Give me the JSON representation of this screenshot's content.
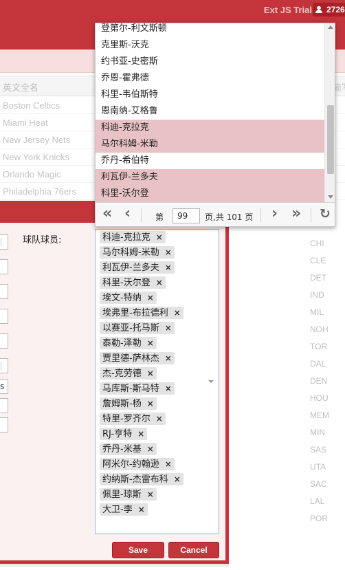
{
  "topbar": {
    "trial_label": "Ext JS Trial",
    "user_count": "2726"
  },
  "grid": {
    "header": "英文全名",
    "header_edge": "简写",
    "rows": [
      "Boston Celtics",
      "Miami Heat",
      "New Jersey Nets",
      "New York Knicks",
      "Orlando Magic",
      "Philadelphia 76ers"
    ],
    "codes": [
      "CHI",
      "CLE",
      "DET",
      "IND",
      "MIL",
      "NOH",
      "TOR",
      "DAL",
      "DEN",
      "HOU",
      "MEM",
      "MIN",
      "SAS",
      "UTA",
      "SAC",
      "LAL",
      "POR"
    ]
  },
  "form": {
    "players_label": "球队球员:",
    "stub_value": "s",
    "selected_players": [
      "科迪-克拉克",
      "马尔科姆-米勒",
      "利瓦伊-兰多夫",
      "科里-沃尔登",
      "埃文-特纳",
      "埃弗里-布拉德利",
      "以赛亚-托马斯",
      "泰勒-泽勒",
      "贾里德-萨林杰",
      "杰-克劳德",
      "马库斯-斯马特",
      "詹姆斯-杨",
      "特里-罗齐尔",
      "RJ-亨特",
      "乔丹-米基",
      "阿米尔-约翰逊",
      "约纳斯-杰雷布科",
      "佩里-琼斯",
      "大卫-李"
    ]
  },
  "buttons": {
    "save": "Save",
    "cancel": "Cancel"
  },
  "picker": {
    "items": [
      {
        "label": "登第尔-利文斯顿",
        "selected": false
      },
      {
        "label": "克里斯-沃克",
        "selected": false
      },
      {
        "label": "约书亚-史密斯",
        "selected": false
      },
      {
        "label": "乔恩-霍弗德",
        "selected": false
      },
      {
        "label": "科里-韦伯斯特",
        "selected": false
      },
      {
        "label": "恩南纳-艾格鲁",
        "selected": false
      },
      {
        "label": "科迪-克拉克",
        "selected": true
      },
      {
        "label": "马尔科姆-米勒",
        "selected": true
      },
      {
        "label": "乔丹-希伯特",
        "selected": false
      },
      {
        "label": "利瓦伊-兰多夫",
        "selected": true
      },
      {
        "label": "科里-沃尔登",
        "selected": true
      }
    ],
    "pager": {
      "page_prefix": "第",
      "current_page": "99",
      "page_suffix": "页,共 101 页"
    }
  }
}
